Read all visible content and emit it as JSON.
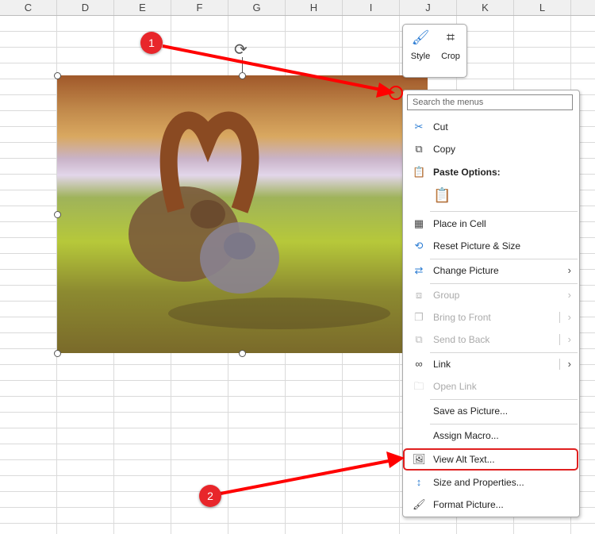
{
  "columns": [
    "C",
    "D",
    "E",
    "F",
    "G",
    "H",
    "I",
    "J",
    "K",
    "L"
  ],
  "mini_toolbar": {
    "style_label": "Style",
    "crop_label": "Crop"
  },
  "context_menu": {
    "search_placeholder": "Search the menus",
    "items": [
      {
        "label": "Cut",
        "icon": "scissors-icon",
        "enabled": true
      },
      {
        "label": "Copy",
        "icon": "copy-icon",
        "enabled": true
      },
      {
        "label": "Paste Options:",
        "icon": "paste-icon",
        "enabled": true
      },
      {
        "label": "Place in Cell",
        "icon": "place-in-cell-icon",
        "enabled": true
      },
      {
        "label": "Reset Picture & Size",
        "icon": "reset-picture-icon",
        "enabled": true
      },
      {
        "label": "Change Picture",
        "icon": "change-picture-icon",
        "enabled": true,
        "submenu": true
      },
      {
        "label": "Group",
        "icon": "group-icon",
        "enabled": false,
        "submenu": true
      },
      {
        "label": "Bring to Front",
        "icon": "bring-front-icon",
        "enabled": false,
        "submenu": true
      },
      {
        "label": "Send to Back",
        "icon": "send-back-icon",
        "enabled": false,
        "submenu": true
      },
      {
        "label": "Link",
        "icon": "link-icon",
        "enabled": true,
        "submenu": true
      },
      {
        "label": "Open Link",
        "icon": "open-link-icon",
        "enabled": false
      },
      {
        "label": "Save as Picture...",
        "enabled": true
      },
      {
        "label": "Assign Macro...",
        "enabled": true
      },
      {
        "label": "View Alt Text...",
        "icon": "alt-text-icon",
        "enabled": true,
        "highlighted": true
      },
      {
        "label": "Size and Properties...",
        "icon": "size-properties-icon",
        "enabled": true
      },
      {
        "label": "Format Picture...",
        "icon": "format-picture-icon",
        "enabled": true
      }
    ]
  },
  "annotations": [
    {
      "label": "1"
    },
    {
      "label": "2"
    }
  ],
  "colors": {
    "annotation": "#e8262b",
    "accent": "#2b7cd3"
  }
}
